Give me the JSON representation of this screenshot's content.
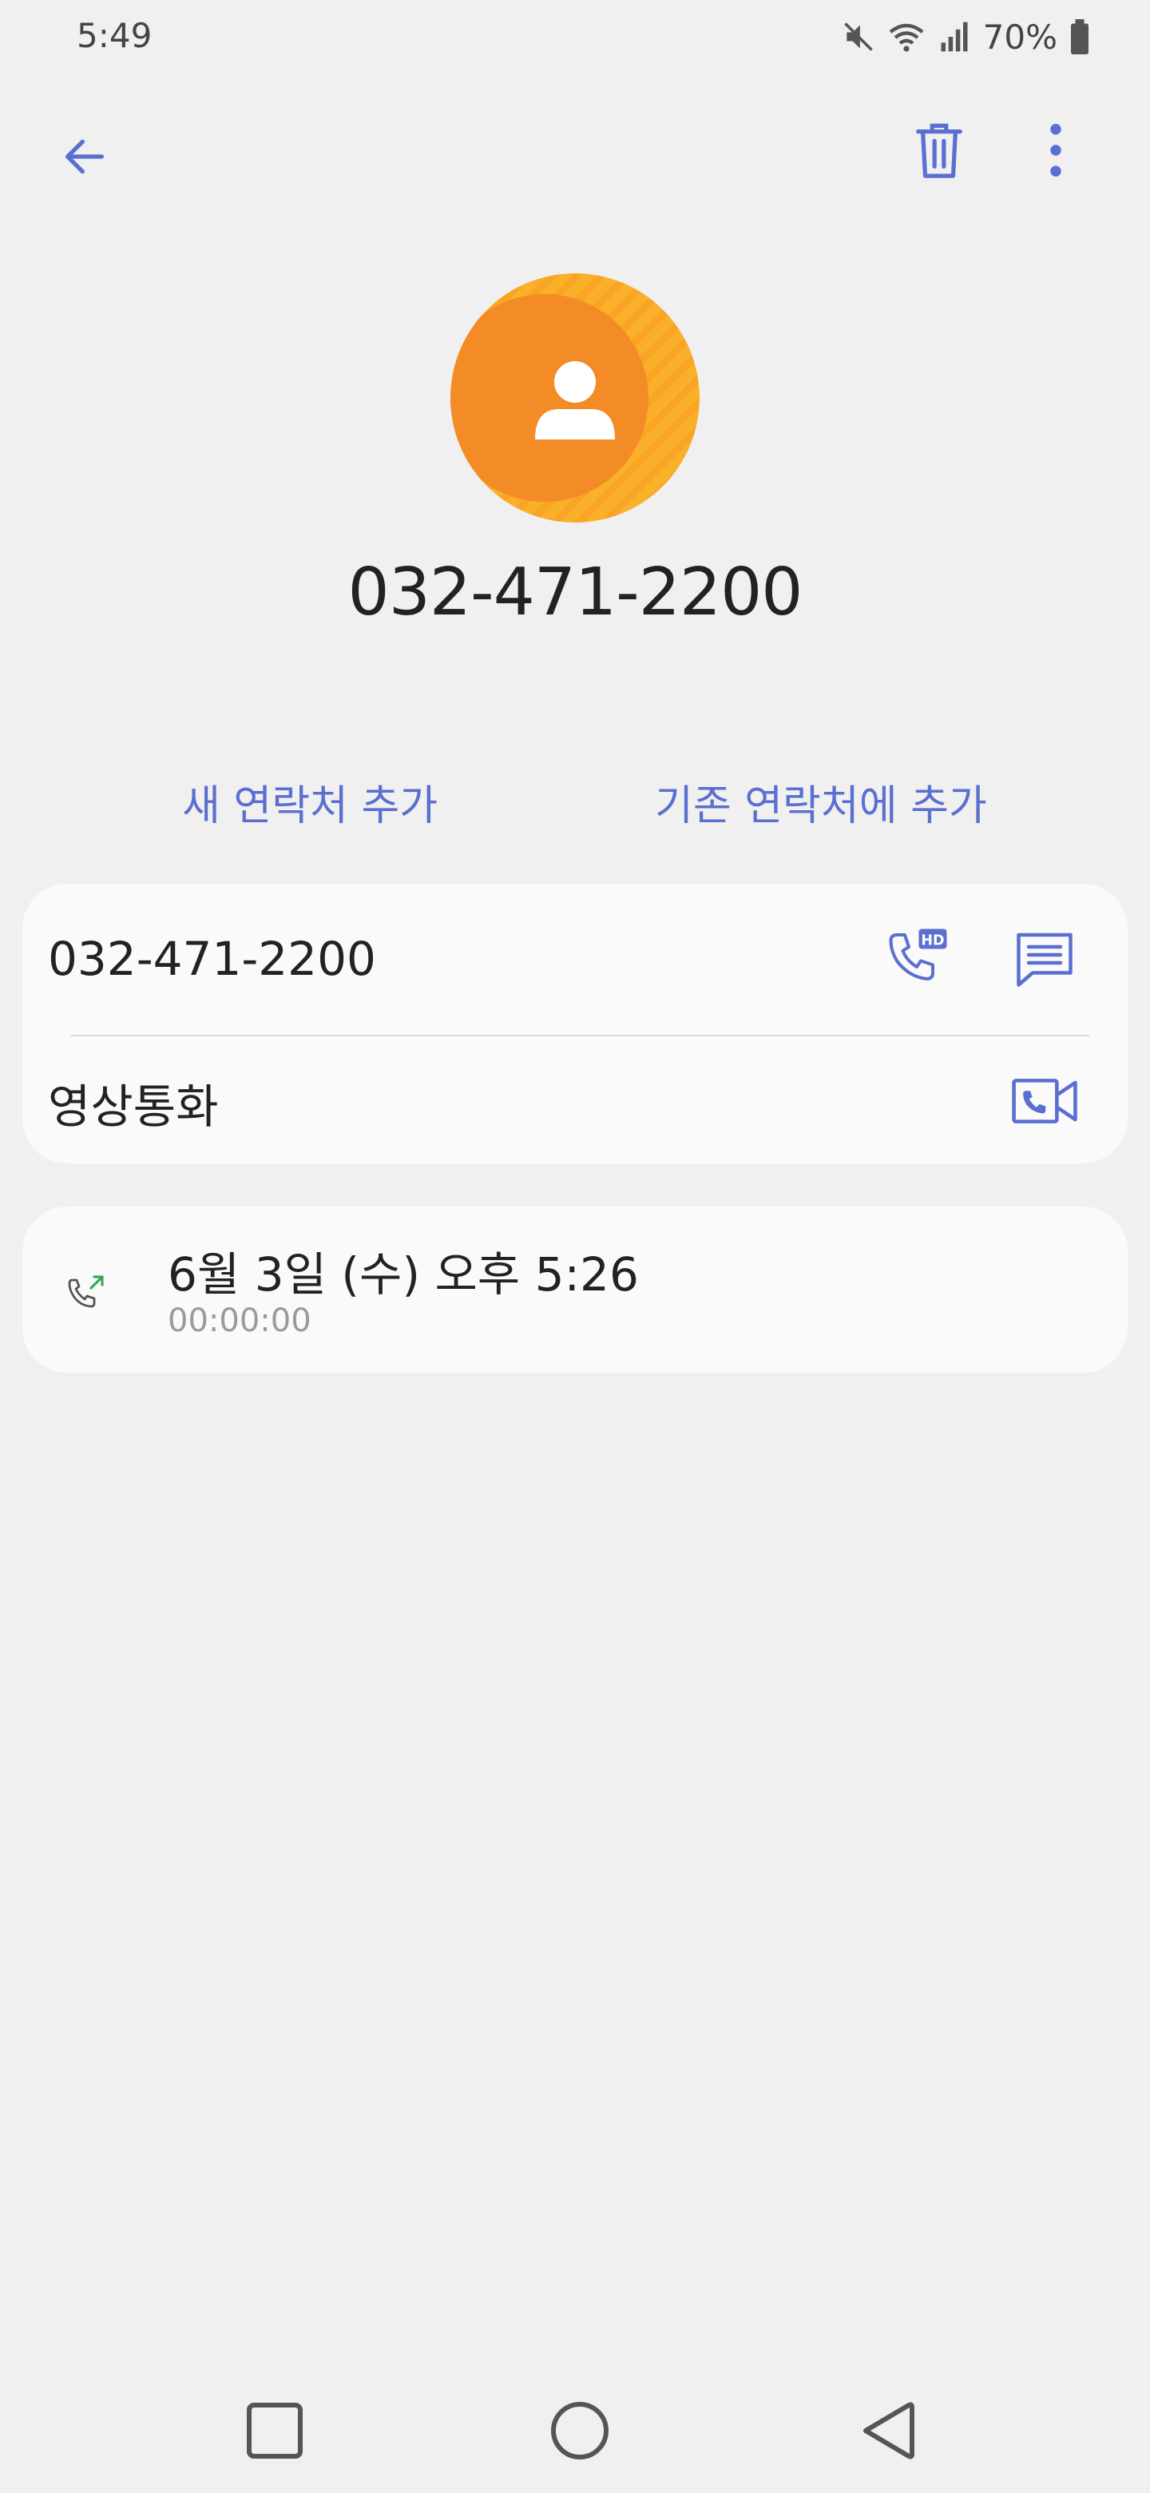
{
  "status_bar": {
    "time": "5:49",
    "battery_percent": "70%",
    "icons": [
      "mute-icon",
      "wifi-icon",
      "signal-icon",
      "battery-icon"
    ]
  },
  "toolbar": {
    "icons": [
      "back-arrow-icon",
      "trash-icon",
      "more-vert-icon"
    ]
  },
  "contact": {
    "number": "032-471-2200",
    "avatar_colors": [
      "#f28a26",
      "#fbb02a"
    ]
  },
  "actions": {
    "add_new_contact": "새 연락처 추가",
    "add_to_existing": "기존 연락처에 추가"
  },
  "details": {
    "phone_number": "032-471-2200",
    "video_call_label": "영상통화",
    "icons": [
      "hd-call-icon",
      "message-icon",
      "video-call-icon"
    ]
  },
  "call_log": {
    "date": "6월 3일 (수) 오후 5:26",
    "duration": "00:00:00",
    "type_icon": "outgoing-call-icon"
  },
  "nav_bar": {
    "icons": [
      "recents-square-icon",
      "home-circle-icon",
      "back-triangle-icon"
    ]
  },
  "colors": {
    "accent": "#5b6fd0",
    "background": "#f0f0f0",
    "card": "#fafafa"
  }
}
